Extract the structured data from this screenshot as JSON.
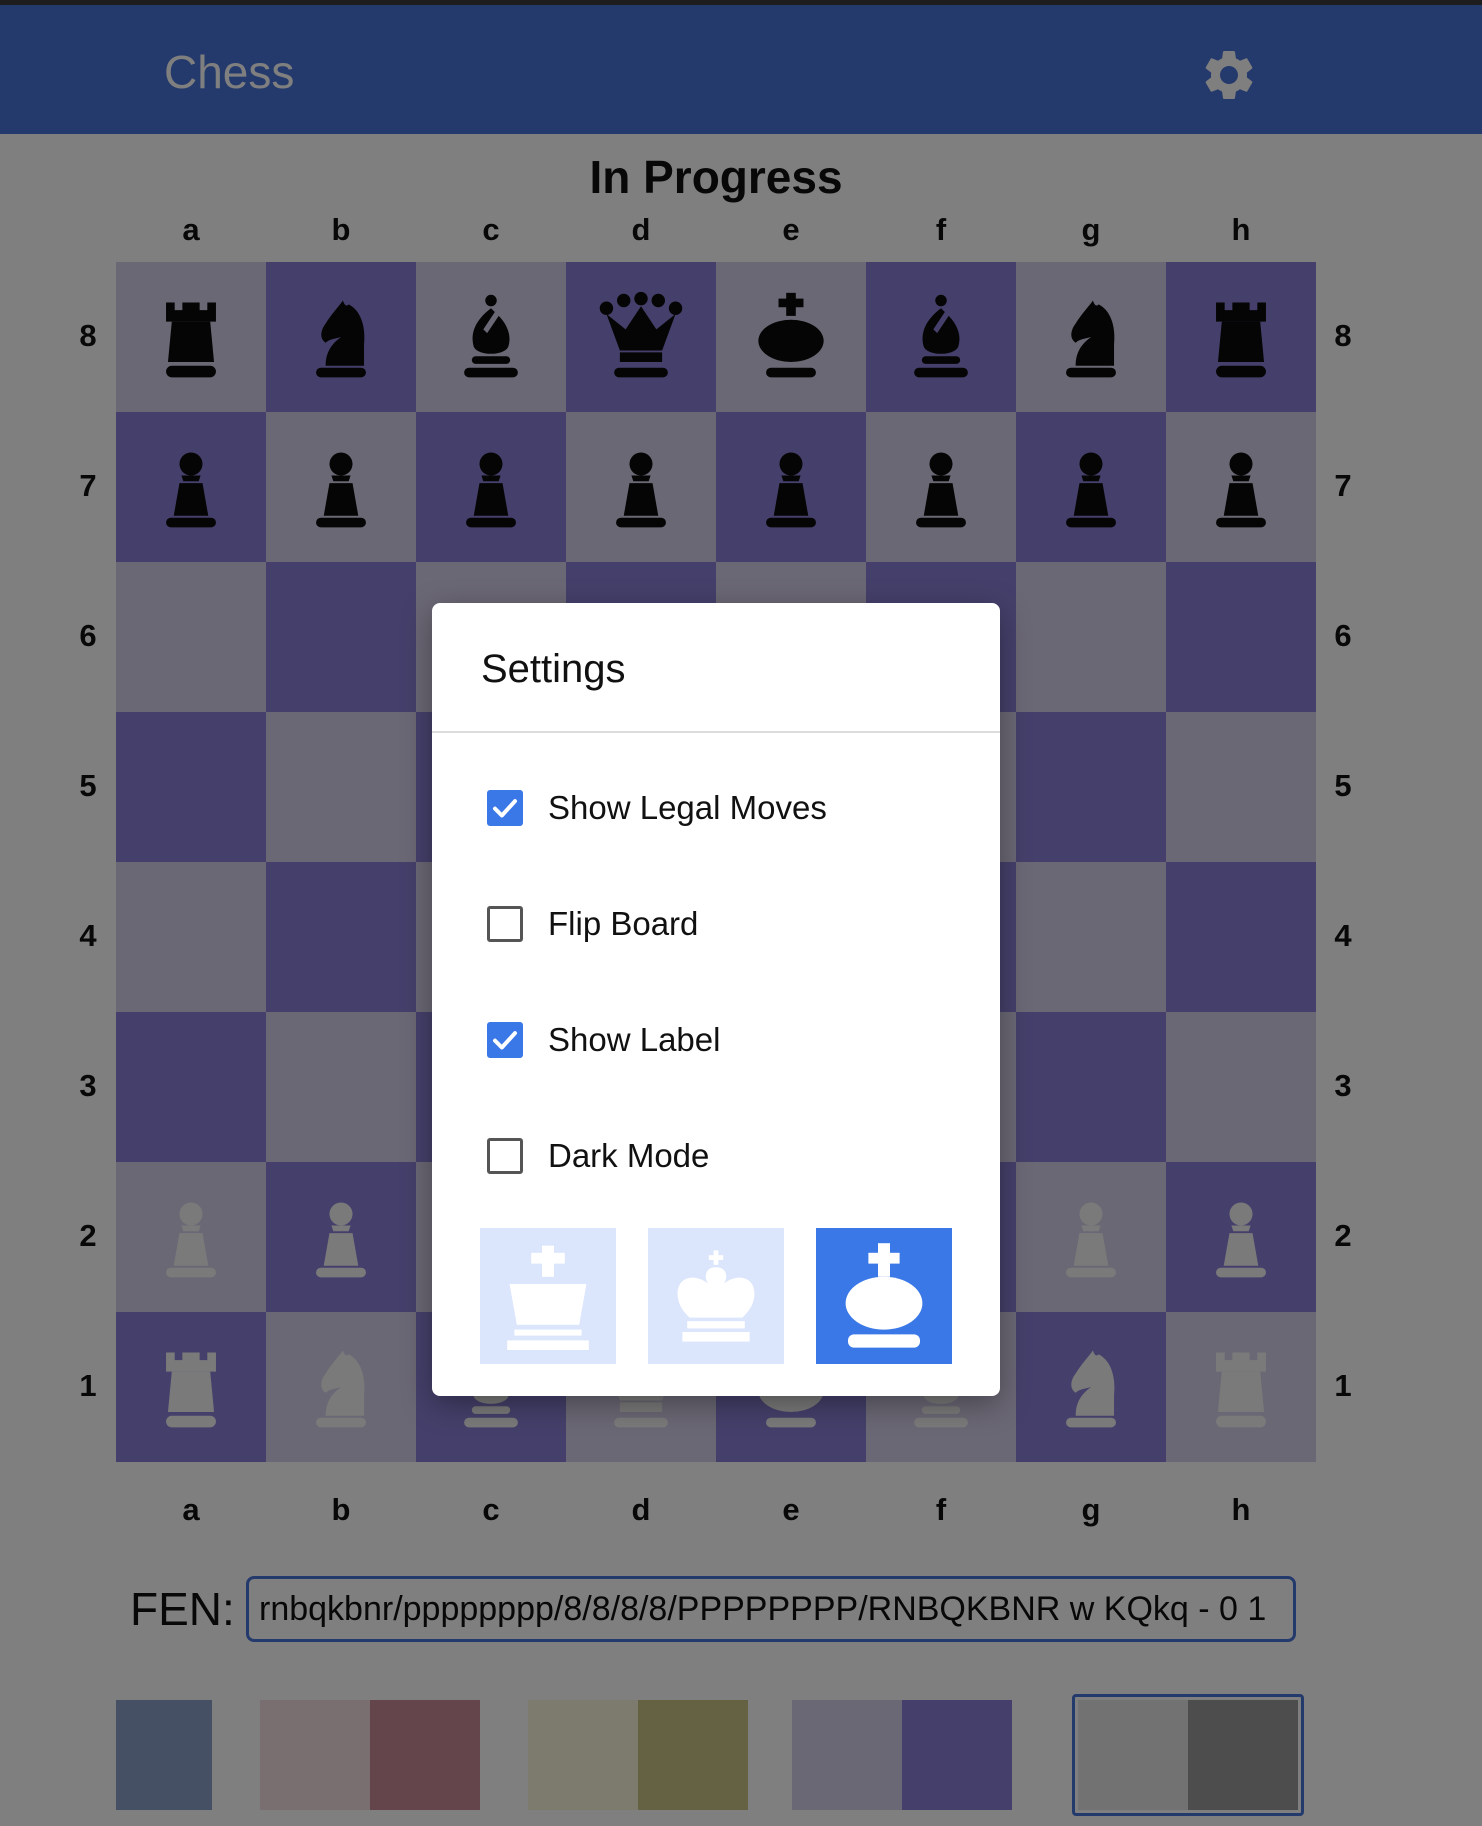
{
  "header": {
    "title": "Chess"
  },
  "game": {
    "status": "In Progress"
  },
  "board": {
    "files": [
      "a",
      "b",
      "c",
      "d",
      "e",
      "f",
      "g",
      "h"
    ],
    "ranks": [
      "8",
      "7",
      "6",
      "5",
      "4",
      "3",
      "2",
      "1"
    ],
    "rows": [
      [
        "bR",
        "bN",
        "bB",
        "bQ",
        "bK",
        "bB",
        "bN",
        "bR"
      ],
      [
        "bP",
        "bP",
        "bP",
        "bP",
        "bP",
        "bP",
        "bP",
        "bP"
      ],
      [
        "",
        "",
        "",
        "",
        "",
        "",
        "",
        ""
      ],
      [
        "",
        "",
        "",
        "",
        "",
        "",
        "",
        ""
      ],
      [
        "",
        "",
        "",
        "",
        "",
        "",
        "",
        ""
      ],
      [
        "",
        "",
        "",
        "",
        "",
        "",
        "",
        ""
      ],
      [
        "wP",
        "wP",
        "wP",
        "wP",
        "wP",
        "wP",
        "wP",
        "wP"
      ],
      [
        "wR",
        "wN",
        "wB",
        "wQ",
        "wK",
        "wB",
        "wN",
        "wR"
      ]
    ],
    "light_color": "#d6d1ea",
    "dark_color": "#8a80d6"
  },
  "fen": {
    "label": "FEN:",
    "value": "rnbqkbnr/pppppppp/8/8/8/8/PPPPPPPP/RNBQKBNR w KQkq - 0 1"
  },
  "themes": [
    {
      "light": "#8aa1c9",
      "dark": "#8aa1c9",
      "selected": false
    },
    {
      "light": "#f3dce0",
      "dark": "#c98b96",
      "selected": false
    },
    {
      "light": "#fbf5dc",
      "dark": "#c9c587",
      "selected": false
    },
    {
      "light": "#d6d1ea",
      "dark": "#8a80d6",
      "selected": true
    },
    {
      "light": "#e4e4e4",
      "dark": "#9a9a9a",
      "selected": false
    }
  ],
  "settings_modal": {
    "title": "Settings",
    "options": [
      {
        "label": "Show Legal Moves",
        "checked": true
      },
      {
        "label": "Flip Board",
        "checked": false
      },
      {
        "label": "Show Label",
        "checked": true
      },
      {
        "label": "Dark Mode",
        "checked": false
      }
    ],
    "piece_styles": [
      {
        "icon": "king-classic-icon",
        "selected": false
      },
      {
        "icon": "king-crown-icon",
        "selected": false
      },
      {
        "icon": "king-solid-icon",
        "selected": true
      }
    ]
  },
  "colors": {
    "accent": "#4a74d8",
    "checkbox_checked": "#3b78e7"
  }
}
